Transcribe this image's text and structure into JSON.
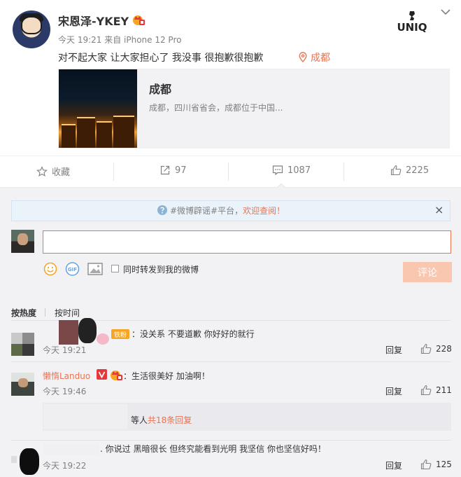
{
  "post": {
    "username": "宋恩泽-YKEY",
    "meta": "今天 19:21 来自 iPhone 12 Pro",
    "text": "对不起大家 让大家担心了 我没事 很抱歉很抱歉",
    "location": "成都",
    "card": {
      "title": "成都",
      "desc": "成都，四川省省会，成都位于中国..."
    },
    "logo_text": "UNIQ"
  },
  "actions": {
    "favorite": "收藏",
    "repost": "97",
    "comment": "1087",
    "like": "2225"
  },
  "notice": {
    "prefix": "#微博辟谣#平台，",
    "highlight": "欢迎查阅！",
    "close": "×"
  },
  "composer": {
    "value": "",
    "repost_label": "同时转发到我的微博",
    "submit_label": "评论",
    "gif_label": "GIF"
  },
  "sort": {
    "hot": "按热度",
    "time": "按时间"
  },
  "comments": [
    {
      "name": "",
      "badge": "铁粉",
      "text": "：没关系 不要道歉 你好好的就行",
      "time": "今天 19:21",
      "reply": "回复",
      "likes": "228"
    },
    {
      "name": "懒惰Landuo",
      "text": "：生活很美好 加油啊！",
      "time": "今天 19:46",
      "reply": "回复",
      "likes": "211",
      "sub": {
        "prefix": "等人",
        "highlight": "共18条回复"
      }
    },
    {
      "name": "",
      "text": ". 你说过  黑暗很长 但终究能看到光明  我坚信  你也坚信好吗！",
      "time": "今天 19:22",
      "reply": "回复",
      "likes": "125"
    }
  ],
  "colors": {
    "accent": "#eb7350",
    "muted": "#808080",
    "bg": "#f2f2f5"
  }
}
